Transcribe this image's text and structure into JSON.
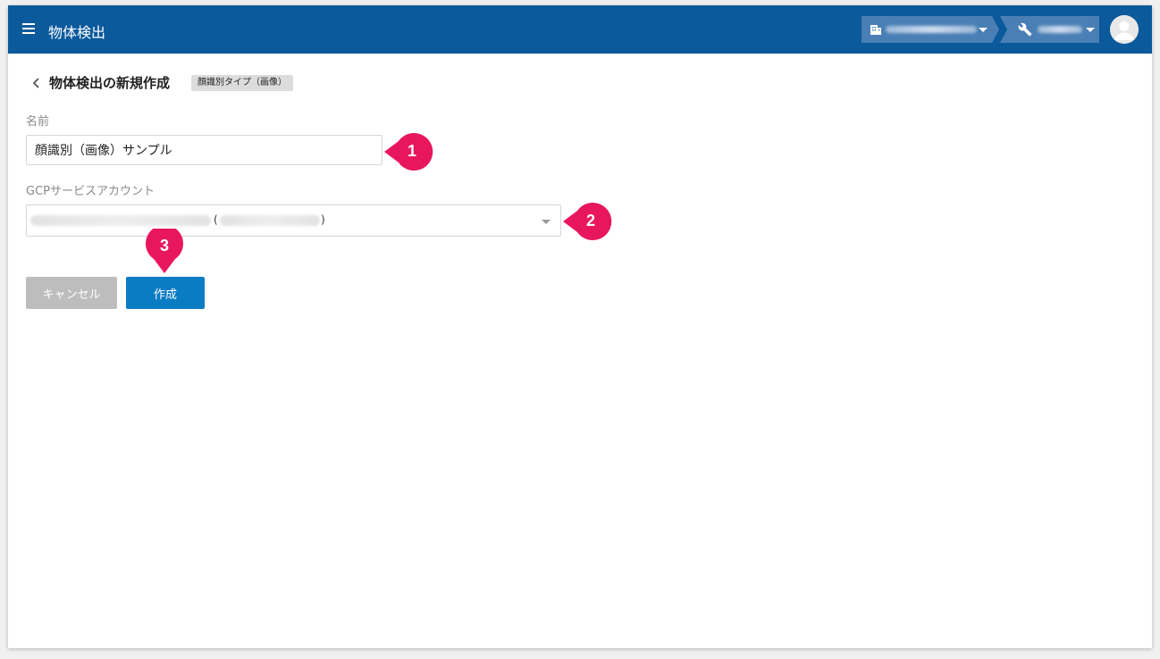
{
  "app": {
    "title": "物体検出",
    "org_selector_value": "",
    "project_selector_value": ""
  },
  "page": {
    "title": "物体検出の新規作成",
    "type_badge": "顔識別タイプ（画像）"
  },
  "form": {
    "name_label": "名前",
    "name_value": "顔識別（画像）サンプル",
    "gcp_label": "GCPサービスアカウント",
    "gcp_open_paren": "(",
    "gcp_close_paren": ")"
  },
  "buttons": {
    "cancel": "キャンセル",
    "create": "作成"
  },
  "callouts": {
    "one": "1",
    "two": "2",
    "three": "3",
    "color": "#e8175d"
  },
  "colors": {
    "appbar": "#0a5a9c",
    "primary_button": "#0a7cc4",
    "cancel_button": "#bdbdbd"
  },
  "icons": [
    "menu-icon",
    "chevron-left-icon",
    "building-icon",
    "wrench-icon",
    "caret-down-icon",
    "user-avatar-icon"
  ]
}
